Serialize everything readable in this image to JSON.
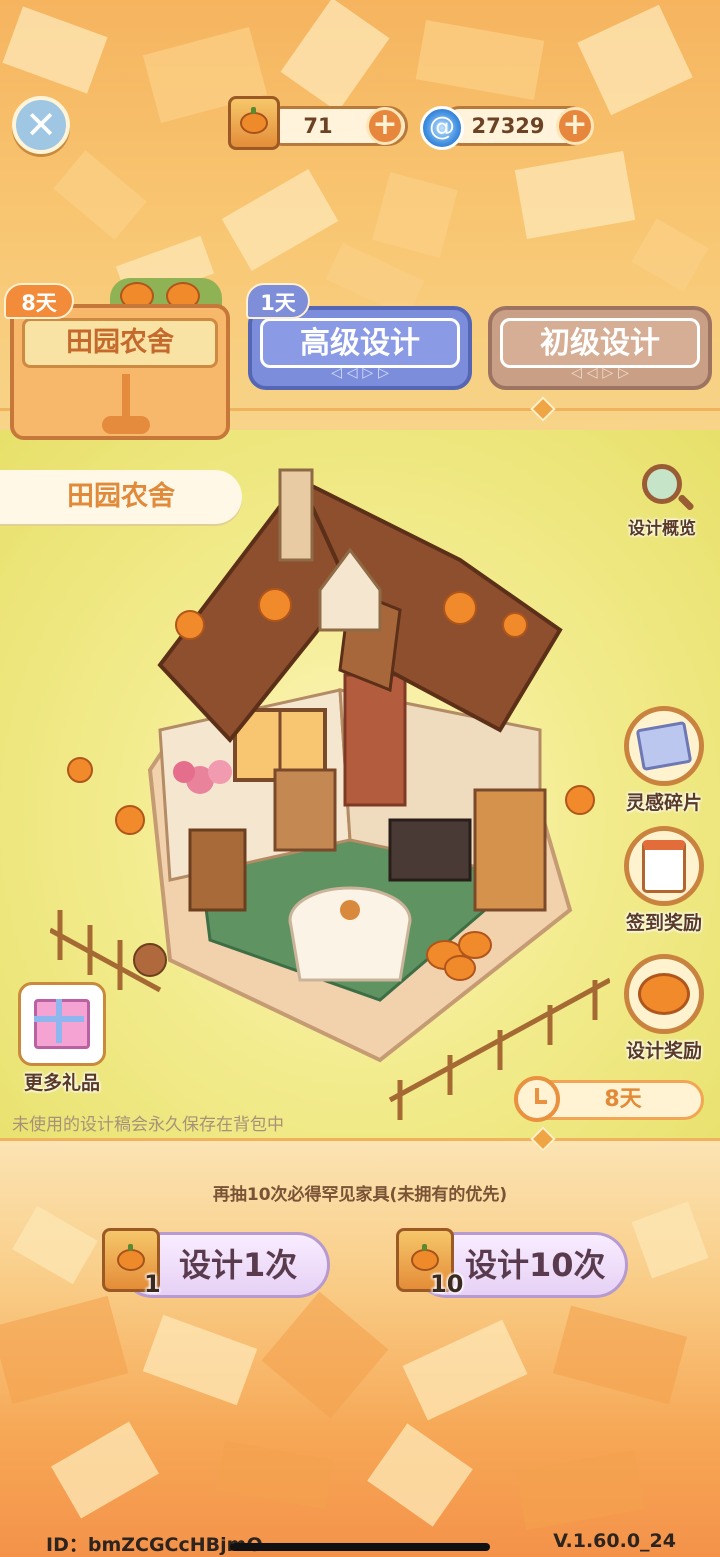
{
  "currencies": {
    "scroll_count": "71",
    "gems": "27329"
  },
  "tabs": {
    "farmhouse": {
      "badge": "8天",
      "label": "田园农舍"
    },
    "advanced": {
      "badge": "1天",
      "label": "高级设计",
      "arrows": "◁ ◁ ▷ ▷"
    },
    "basic": {
      "label": "初级设计",
      "arrows": "◁ ◁ ▷ ▷"
    }
  },
  "banner": {
    "title": "田园农舍"
  },
  "side_buttons": {
    "overview": "设计概览",
    "fragments": "灵感碎片",
    "checkin": "签到奖励",
    "design_reward": "设计奖励",
    "more_gifts": "更多礼品"
  },
  "timer": {
    "value": "8天"
  },
  "notes": {
    "storage": "未使用的设计稿会永久保存在背包中",
    "pity": "再抽10次必得罕见家具(未拥有的优先)"
  },
  "draw": {
    "single": {
      "label": "设计1次",
      "cost": "1"
    },
    "ten": {
      "label": "设计10次",
      "cost": "10"
    }
  },
  "footer": {
    "id": "ID：bmZCGCcHBjmO",
    "version": "V.1.60.0_24"
  },
  "colors": {
    "accent_orange": "#f28c3a",
    "advanced_tab": "#7c8ddc",
    "basic_tab": "#c99f86",
    "draw_button": "#e6d1f5"
  }
}
